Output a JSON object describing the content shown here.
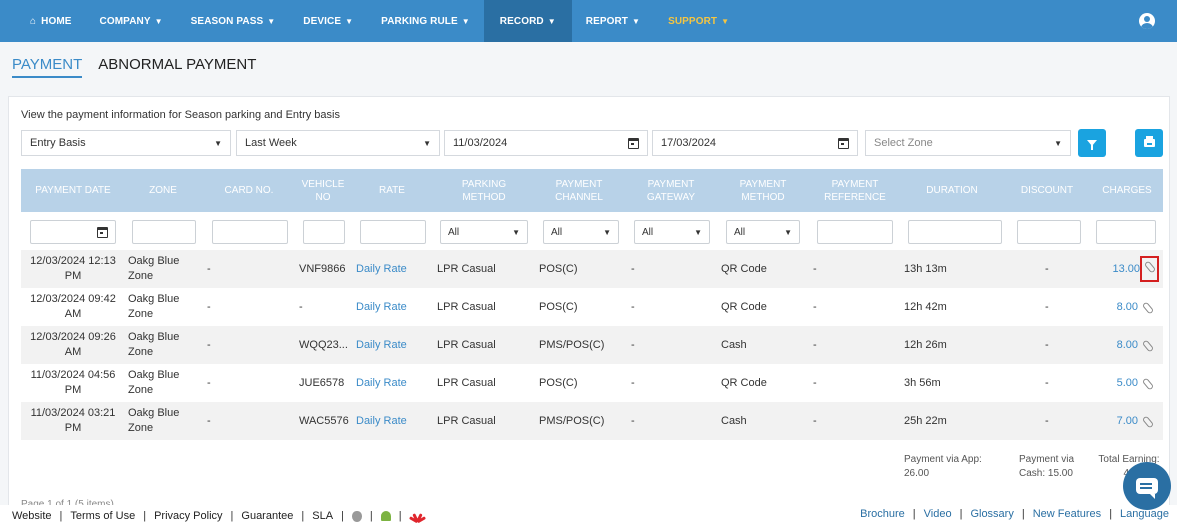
{
  "nav": {
    "home": "HOME",
    "items": [
      "COMPANY",
      "SEASON PASS",
      "DEVICE",
      "PARKING RULE",
      "RECORD",
      "REPORT",
      "SUPPORT"
    ],
    "user_icon": "user-circle-icon"
  },
  "tabs": [
    "PAYMENT",
    "ABNORMAL PAYMENT"
  ],
  "description": "View the payment information for Season parking and Entry basis",
  "filters": {
    "basis": "Entry Basis",
    "period": "Last Week",
    "start_date": "11/03/2024",
    "end_date": "17/03/2024",
    "zone_placeholder": "Select Zone"
  },
  "columns": [
    "PAYMENT DATE",
    "ZONE",
    "CARD NO.",
    "VEHICLE NO",
    "RATE",
    "PARKING METHOD",
    "PAYMENT CHANNEL",
    "PAYMENT GATEWAY",
    "PAYMENT METHOD",
    "PAYMENT REFERENCE",
    "DURATION",
    "DISCOUNT",
    "CHARGES"
  ],
  "column_filters": {
    "all": "All"
  },
  "rows": [
    {
      "date": "12/03/2024 12:13 PM",
      "zone": "Oakg Blue Zone",
      "card": "-",
      "vehicle": "VNF9866",
      "rate": "Daily Rate",
      "method": "LPR Casual",
      "channel": "POS(C)",
      "gateway": "-",
      "pay_method": "QR Code",
      "reference": "-",
      "duration": "13h 13m",
      "discount": "-",
      "charges": "13.00"
    },
    {
      "date": "12/03/2024 09:42 AM",
      "zone": "Oakg Blue Zone",
      "card": "-",
      "vehicle": "-",
      "rate": "Daily Rate",
      "method": "LPR Casual",
      "channel": "POS(C)",
      "gateway": "-",
      "pay_method": "QR Code",
      "reference": "-",
      "duration": "12h 42m",
      "discount": "-",
      "charges": "8.00"
    },
    {
      "date": "12/03/2024 09:26 AM",
      "zone": "Oakg Blue Zone",
      "card": "-",
      "vehicle": "WQQ23...",
      "rate": "Daily Rate",
      "method": "LPR Casual",
      "channel": "PMS/POS(C)",
      "gateway": "-",
      "pay_method": "Cash",
      "reference": "-",
      "duration": "12h 26m",
      "discount": "-",
      "charges": "8.00"
    },
    {
      "date": "11/03/2024 04:56 PM",
      "zone": "Oakg Blue Zone",
      "card": "-",
      "vehicle": "JUE6578",
      "rate": "Daily Rate",
      "method": "LPR Casual",
      "channel": "POS(C)",
      "gateway": "-",
      "pay_method": "QR Code",
      "reference": "-",
      "duration": "3h 56m",
      "discount": "-",
      "charges": "5.00"
    },
    {
      "date": "11/03/2024 03:21 PM",
      "zone": "Oakg Blue Zone",
      "card": "-",
      "vehicle": "WAC5576",
      "rate": "Daily Rate",
      "method": "LPR Casual",
      "channel": "PMS/POS(C)",
      "gateway": "-",
      "pay_method": "Cash",
      "reference": "-",
      "duration": "25h 22m",
      "discount": "-",
      "charges": "7.00"
    }
  ],
  "summary": {
    "app": "Payment via App: 26.00",
    "cash_label": "Payment via",
    "cash_value": "Cash: 15.00",
    "total_label": "Total Earning:",
    "total_value": "41"
  },
  "pager": "Page 1 of 1 (5 items)",
  "footer": {
    "left": [
      "Website",
      "Terms of Use",
      "Privacy Policy",
      "Guarantee",
      "SLA"
    ],
    "right": [
      "Brochure",
      "Video",
      "Glossary",
      "New Features",
      "Language"
    ]
  }
}
